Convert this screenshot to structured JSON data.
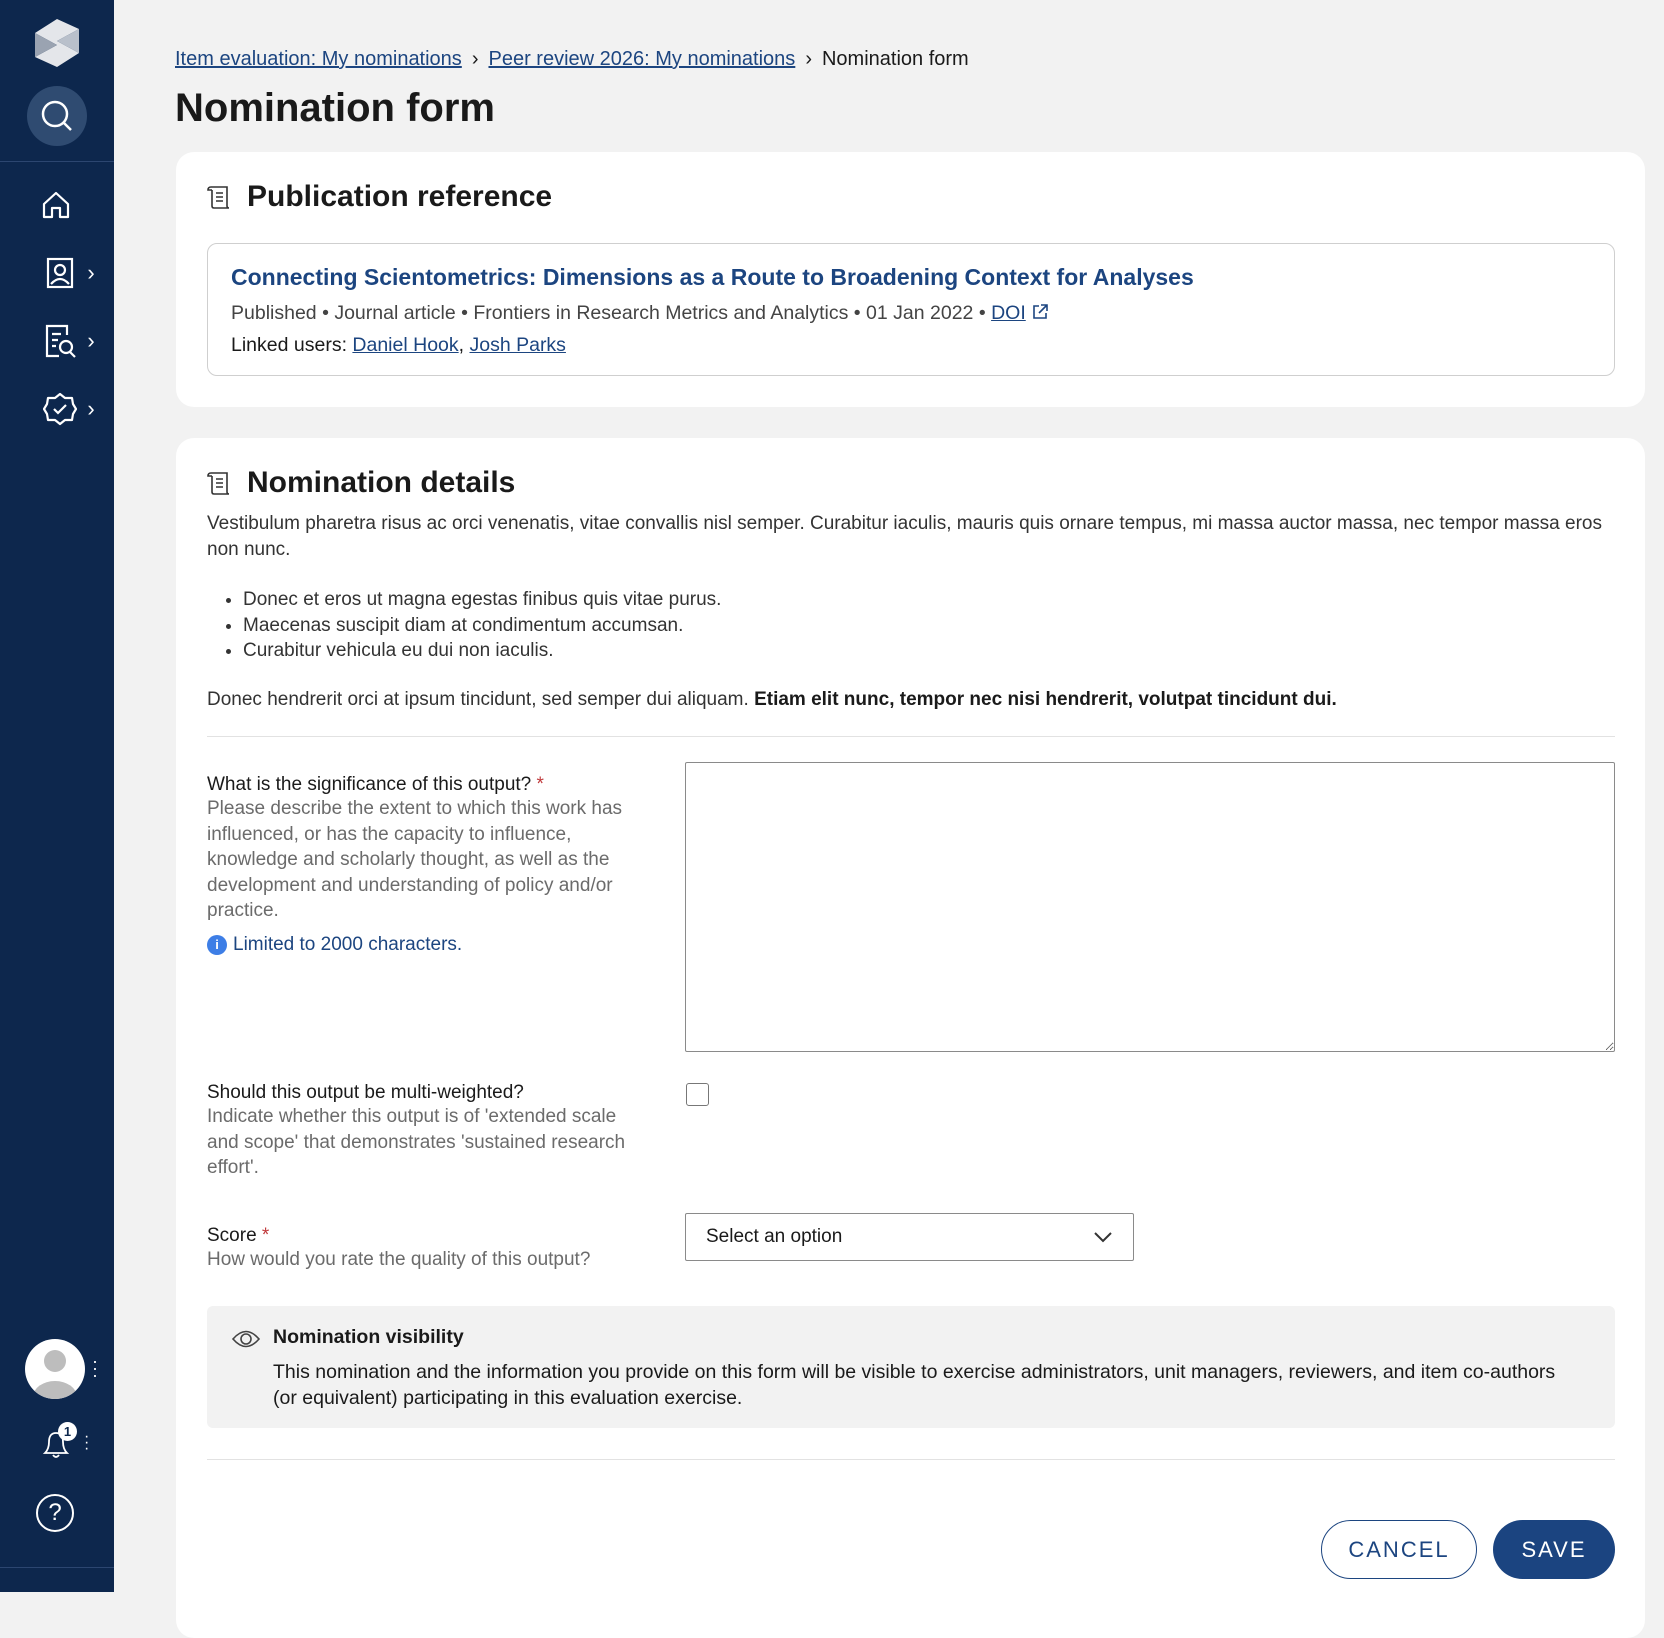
{
  "breadcrumb": [
    {
      "label": "Item evaluation: My nominations"
    },
    {
      "label": "Peer review 2026: My nominations"
    },
    {
      "label": "Nomination form"
    }
  ],
  "page_title": "Nomination form",
  "publication": {
    "heading": "Publication reference",
    "title": "Connecting Scientometrics: Dimensions as a Route to Broadening Context for Analyses",
    "status": "Published",
    "type": "Journal article",
    "journal": "Frontiers in Research Metrics and Analytics",
    "date": "01 Jan 2022",
    "doi_label": "DOI",
    "linked_label": "Linked users:",
    "users": [
      "Daniel Hook",
      "Josh Parks"
    ],
    "sep": ","
  },
  "details": {
    "heading": "Nomination details",
    "intro": "Vestibulum pharetra risus ac orci venenatis, vitae convallis nisl semper. Curabitur iaculis, mauris quis ornare tempus, mi massa auctor massa, nec tempor massa eros non nunc.",
    "bullets": [
      "Donec et eros ut magna egestas finibus quis vitae purus.",
      "Maecenas suscipit diam at condimentum accumsan.",
      "Curabitur vehicula eu dui non iaculis."
    ],
    "outro": "Donec hendrerit orci at ipsum tincidunt, sed semper dui aliquam.",
    "outro_bold": "Etiam elit nunc, tempor nec nisi hendrerit, volutpat tincidunt dui."
  },
  "form": {
    "significance": {
      "label": "What is the significance of this output?",
      "required": "*",
      "help": "Please describe the extent to which this work has influenced, or has the capacity to influence, knowledge and scholarly thought, as well as the development and understanding of policy and/or practice.",
      "limit": "Limited to 2000 characters.",
      "value": ""
    },
    "multi": {
      "label": "Should this output be multi-weighted?",
      "help": "Indicate whether this output is of 'extended scale and scope' that demonstrates 'sustained research effort'.",
      "checked": false
    },
    "score": {
      "label": "Score",
      "required": "*",
      "help": "How would you rate the quality of this output?",
      "selected": "Select an option"
    }
  },
  "visibility": {
    "title": "Nomination visibility",
    "text": "This nomination and the information you provide on this form will be visible to exercise administrators, unit managers, reviewers, and item co-authors (or equivalent) participating in this evaluation exercise."
  },
  "actions": {
    "cancel": "CANCEL",
    "save": "SAVE"
  },
  "notifications": {
    "count": "1"
  },
  "colors": {
    "sidebar": "#0d274d",
    "primary": "#1c4580"
  }
}
